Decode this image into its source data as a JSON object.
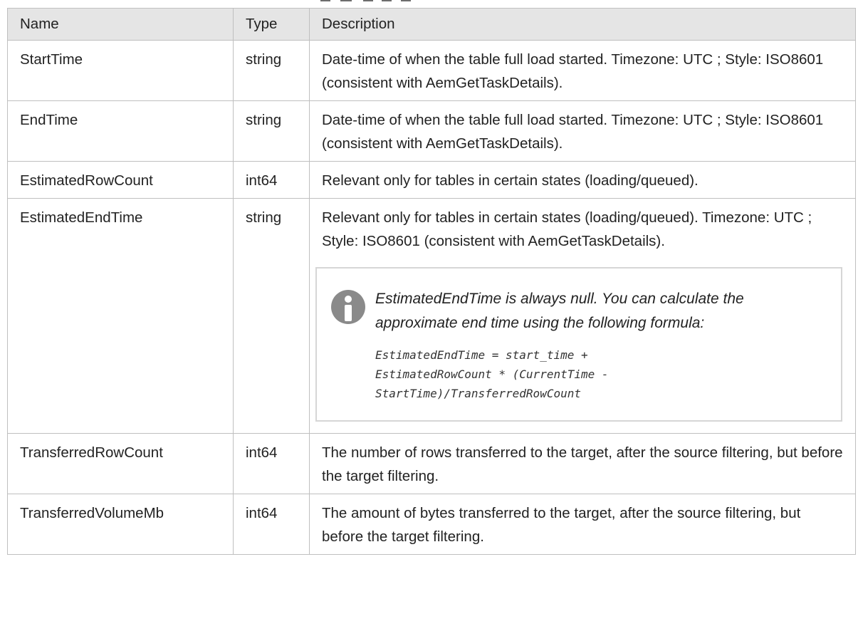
{
  "table": {
    "headers": {
      "name": "Name",
      "type": "Type",
      "description": "Description"
    },
    "rows": [
      {
        "name": "StartTime",
        "type": "string",
        "description": "Date-time of when the table full load started. Timezone: UTC ; Style: ISO8601 (consistent with AemGetTaskDetails)."
      },
      {
        "name": "EndTime",
        "type": "string",
        "description": "Date-time of when the table full load started. Timezone: UTC ; Style: ISO8601 (consistent with AemGetTaskDetails)."
      },
      {
        "name": "EstimatedRowCount",
        "type": "int64",
        "description": "Relevant only for tables in certain states (loading/queued)."
      },
      {
        "name": "EstimatedEndTime",
        "type": "string",
        "description": "Relevant only for tables in certain states (loading/queued). Timezone: UTC ; Style: ISO8601 (consistent with AemGetTaskDetails).",
        "note": {
          "icon": "info-icon",
          "text": "EstimatedEndTime is always null. You can calculate the approximate end time using the following formula:",
          "code_lines": [
            "EstimatedEndTime = start_time +",
            "EstimatedRowCount * (CurrentTime -",
            "StartTime)/TransferredRowCount"
          ]
        }
      },
      {
        "name": "TransferredRowCount",
        "type": "int64",
        "description": "The number of rows transferred to the target, after the source filtering, but before the target filtering."
      },
      {
        "name": "TransferredVolumeMb",
        "type": "int64",
        "description": "The amount of bytes transferred to the target, after the source filtering, but before the target filtering."
      }
    ]
  }
}
